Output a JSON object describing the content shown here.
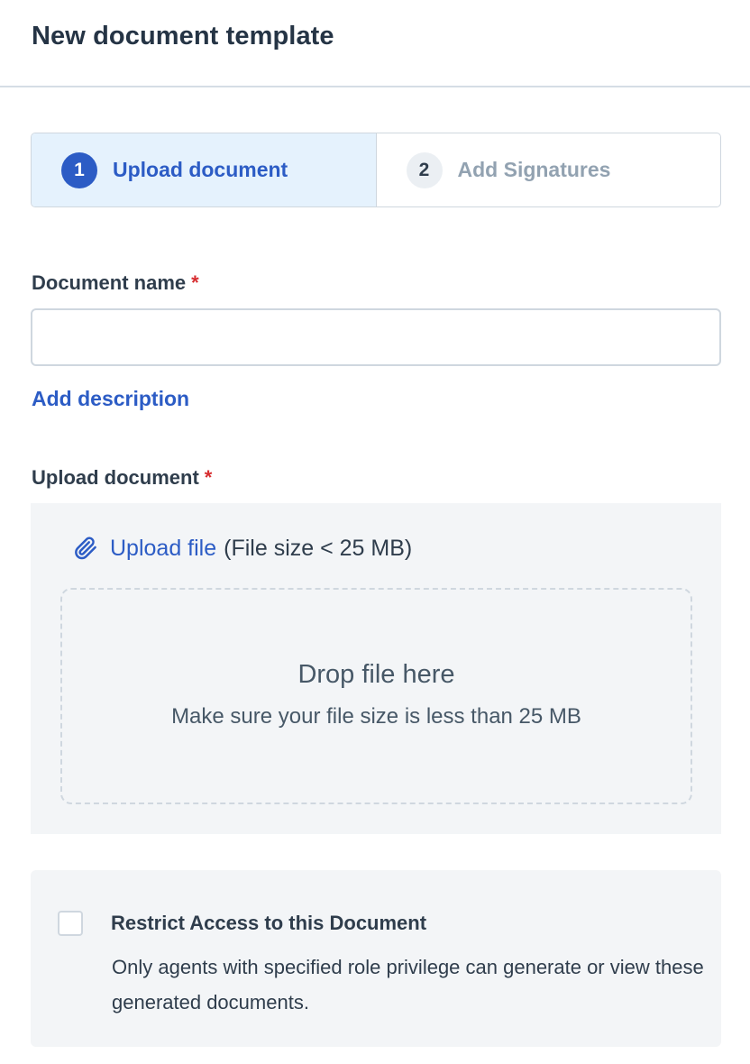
{
  "header": {
    "title": "New document template"
  },
  "stepper": {
    "steps": [
      {
        "number": "1",
        "label": "Upload document",
        "state": "active"
      },
      {
        "number": "2",
        "label": "Add Signatures",
        "state": "inactive"
      }
    ]
  },
  "document_name": {
    "label": "Document name",
    "required_mark": "*",
    "value": "",
    "placeholder": ""
  },
  "add_description_link": "Add description",
  "upload": {
    "label": "Upload document",
    "required_mark": "*",
    "icon": "paperclip-icon",
    "link_text": "Upload file",
    "size_hint": "(File size < 25 MB)",
    "dropzone_title": "Drop file here",
    "dropzone_subtitle": "Make sure your file size is less than 25 MB"
  },
  "restrict_access": {
    "checked": false,
    "title": "Restrict Access to this Document",
    "description": "Only agents with specified role privilege can generate or view these generated documents."
  },
  "colors": {
    "accent": "#2c5cc5",
    "required": "#d72d30",
    "active_step_bg": "#e5f2fd",
    "panel_bg": "#f3f5f7"
  }
}
